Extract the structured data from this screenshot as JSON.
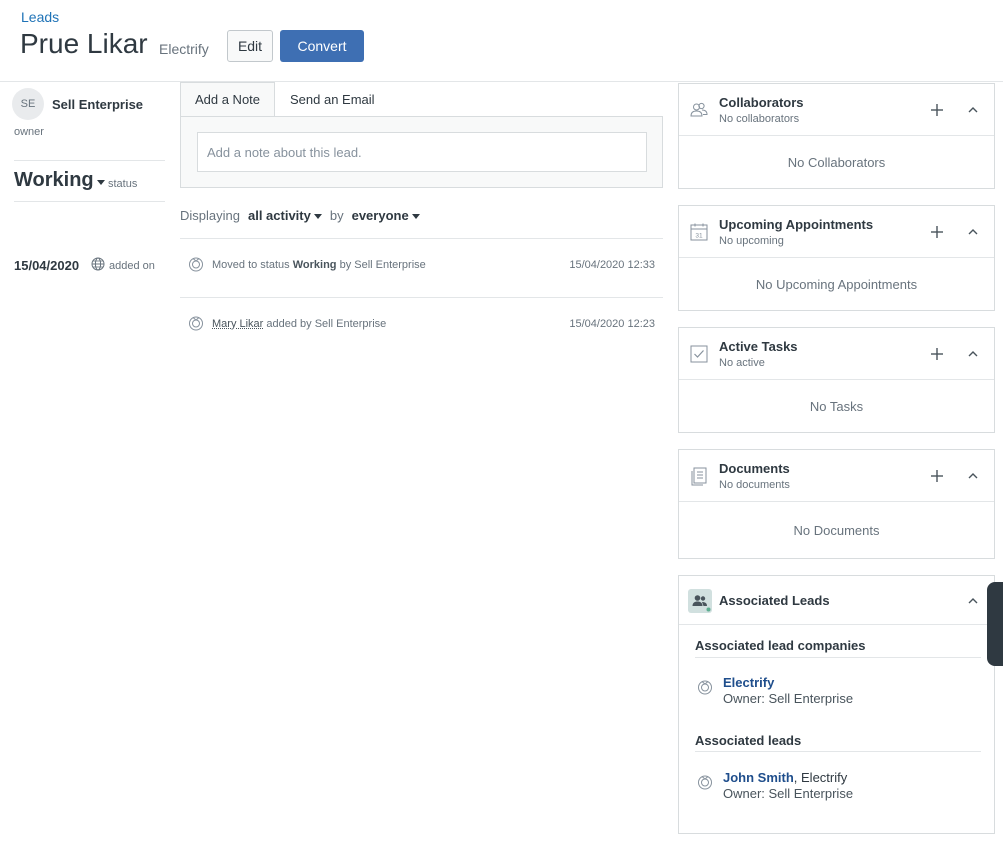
{
  "header": {
    "breadcrumb": "Leads",
    "title": "Prue Likar",
    "company": "Electrify",
    "edit_label": "Edit",
    "convert_label": "Convert"
  },
  "owner": {
    "initials": "SE",
    "name": "Sell Enterprise",
    "label": "owner"
  },
  "status": {
    "value": "Working",
    "label": "status"
  },
  "added": {
    "date": "15/04/2020",
    "label": "added on"
  },
  "tabs": {
    "note": "Add a Note",
    "email": "Send an Email"
  },
  "note": {
    "placeholder": "Add a note about this lead."
  },
  "filter": {
    "prefix": "Displaying",
    "activity": "all activity",
    "by": "by",
    "who": "everyone"
  },
  "activities": [
    {
      "pre": "Moved to status ",
      "bold": "Working",
      "post": " by Sell Enterprise",
      "time": "15/04/2020 12:33"
    },
    {
      "link": "Mary Likar",
      "post": " added by Sell Enterprise",
      "time": "15/04/2020 12:23"
    }
  ],
  "cards": {
    "collaborators": {
      "title": "Collaborators",
      "subtitle": "No collaborators",
      "empty": "No Collaborators"
    },
    "appointments": {
      "title": "Upcoming Appointments",
      "subtitle": "No upcoming",
      "empty": "No Upcoming Appointments",
      "calendar_number": "31"
    },
    "tasks": {
      "title": "Active Tasks",
      "subtitle": "No active",
      "empty": "No Tasks"
    },
    "documents": {
      "title": "Documents",
      "subtitle": "No documents",
      "empty": "No Documents"
    }
  },
  "associated": {
    "title": "Associated Leads",
    "companies_heading": "Associated lead companies",
    "companies": [
      {
        "name": "Electrify",
        "owner": "Owner: Sell Enterprise"
      }
    ],
    "leads_heading": "Associated leads",
    "leads": [
      {
        "name": "John Smith",
        "company": ", Electrify",
        "owner": "Owner: Sell Enterprise"
      }
    ]
  },
  "colors": {
    "primary": "#3e6fb3",
    "link": "#1f73b7",
    "text": "#2f3941",
    "muted": "#68737d",
    "border": "#d8dcde"
  }
}
